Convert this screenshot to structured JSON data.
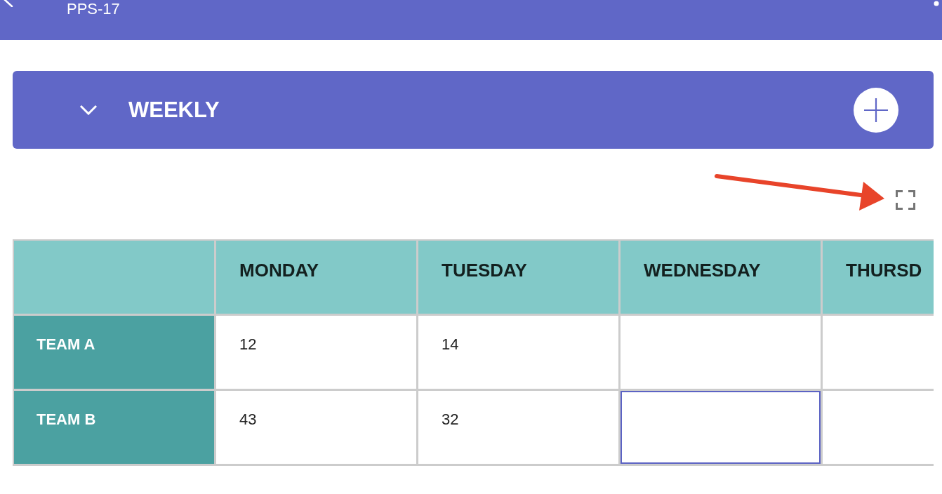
{
  "app_bar": {
    "title": "PPS-17"
  },
  "section": {
    "title": "WEEKLY"
  },
  "table": {
    "columns": [
      "MONDAY",
      "TUESDAY",
      "WEDNESDAY",
      "THURSD"
    ],
    "rows": [
      {
        "label": "TEAM A",
        "cells": [
          {
            "value": "12",
            "selected": false
          },
          {
            "value": "14",
            "selected": false
          },
          {
            "selected": false
          },
          {
            "selected": false
          }
        ]
      },
      {
        "label": "TEAM B",
        "cells": [
          {
            "value": "43",
            "selected": false
          },
          {
            "value": "32",
            "selected": false
          },
          {
            "selected": true
          },
          {
            "selected": false
          }
        ]
      }
    ]
  }
}
